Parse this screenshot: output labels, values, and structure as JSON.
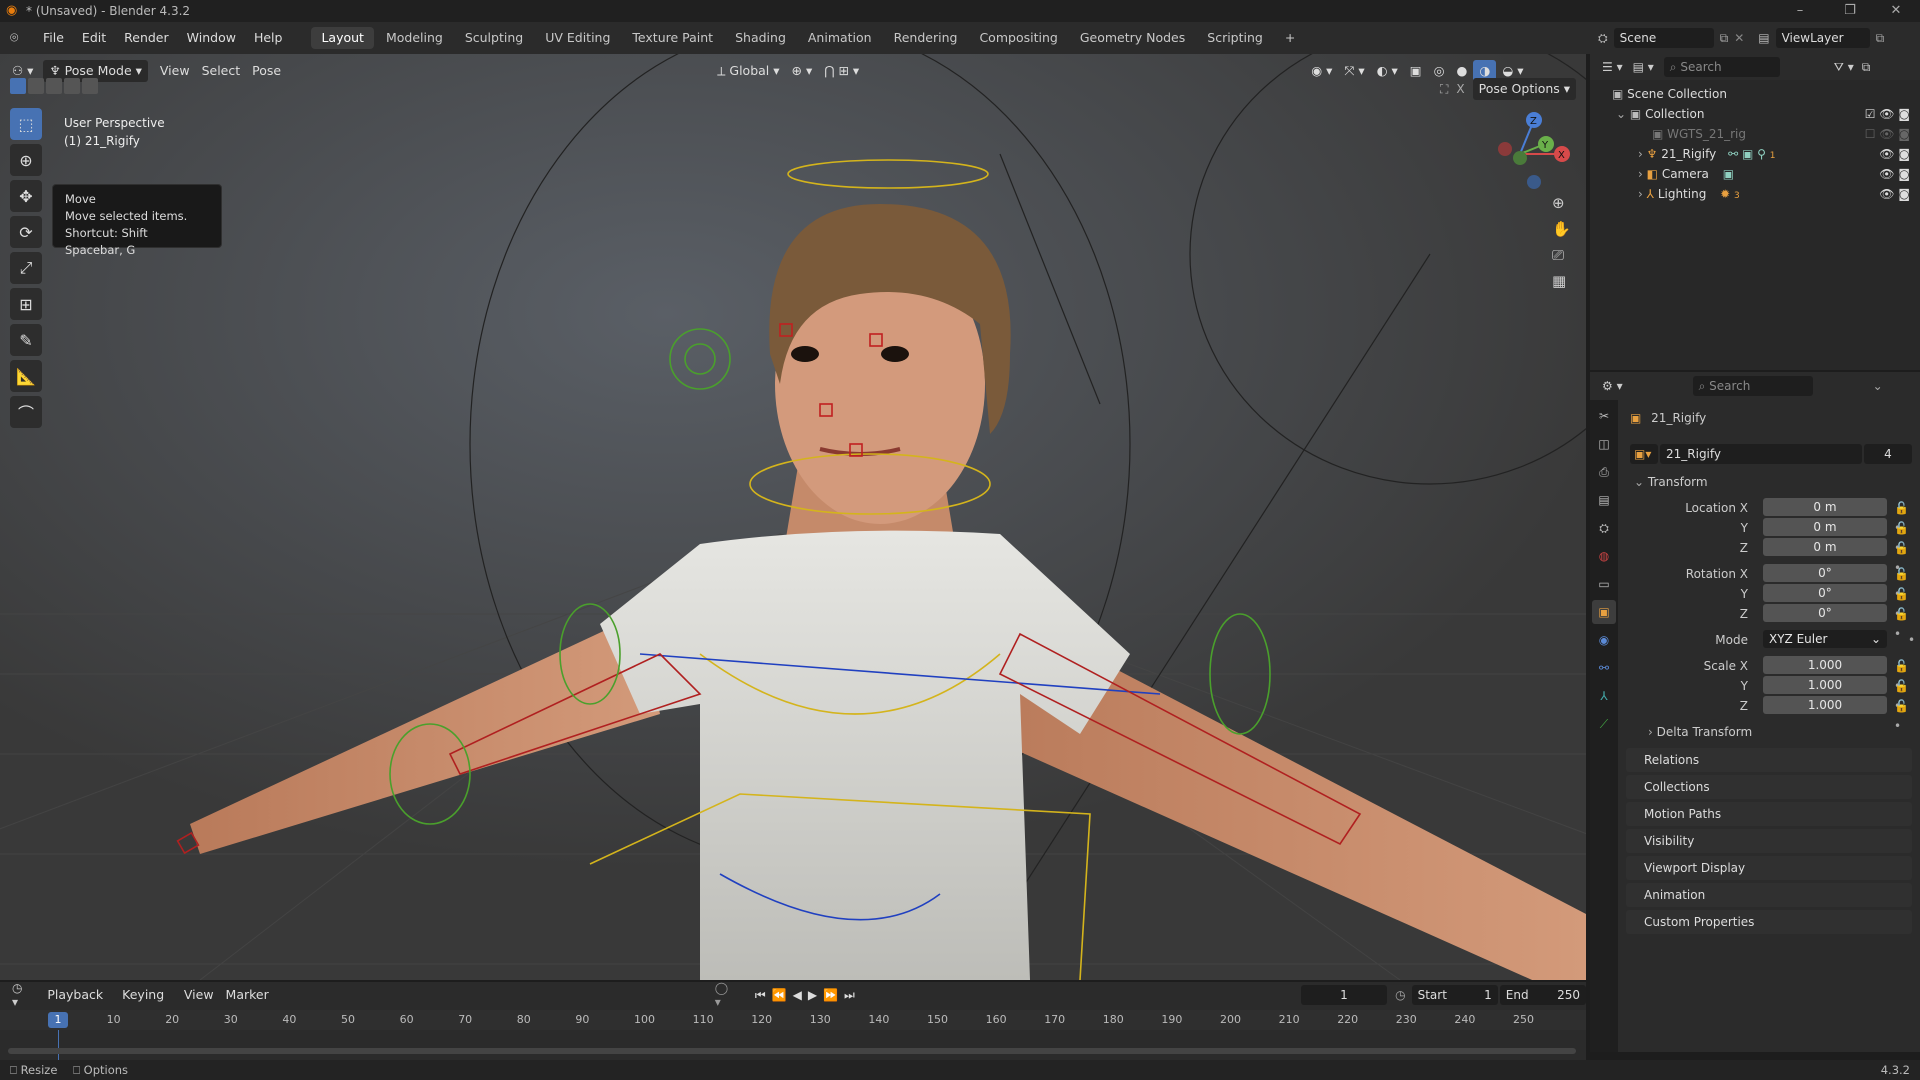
{
  "window": {
    "title": "* (Unsaved) - Blender 4.3.2",
    "controls": [
      "–",
      "❐",
      "✕"
    ]
  },
  "menus": [
    "File",
    "Edit",
    "Render",
    "Window",
    "Help"
  ],
  "workspaces": [
    "Layout",
    "Modeling",
    "Sculpting",
    "UV Editing",
    "Texture Paint",
    "Shading",
    "Animation",
    "Rendering",
    "Compositing",
    "Geometry Nodes",
    "Scripting",
    "+"
  ],
  "scene": {
    "scene_name": "Scene",
    "view_layer": "ViewLayer"
  },
  "viewport": {
    "mode": "Pose Mode",
    "menus": [
      "View",
      "Select",
      "Pose"
    ],
    "orientation": "Global",
    "pose_options": "Pose Options",
    "perspective": "User Perspective",
    "object_label": "(1) 21_Rigify",
    "gizmo_axes": {
      "x": "X",
      "y": "Y",
      "z": "Z"
    },
    "tooltip": {
      "title": "Move",
      "desc": "Move selected items.",
      "shortcut": "Shortcut: Shift Spacebar, G"
    }
  },
  "outliner": {
    "search_placeholder": "Search",
    "items": [
      {
        "label": "Scene Collection",
        "indent": 0
      },
      {
        "label": "Collection",
        "indent": 1
      },
      {
        "label": "WGTS_21_rig",
        "indent": 2
      },
      {
        "label": "21_Rigify",
        "indent": 2
      },
      {
        "label": "Camera",
        "indent": 2
      },
      {
        "label": "Lighting",
        "indent": 2
      }
    ],
    "lighting_count": "3",
    "rigify_count": "1"
  },
  "properties": {
    "search_placeholder": "Search",
    "object_name": "21_Rigify",
    "datablock_name": "21_Rigify",
    "users": "4",
    "transform_title": "Transform",
    "location": {
      "label": "Location X",
      "x": "0 m",
      "y": "0 m",
      "z": "0 m"
    },
    "rotation": {
      "label": "Rotation X",
      "x": "0°",
      "y": "0°",
      "z": "0°"
    },
    "mode_label": "Mode",
    "mode_value": "XYZ Euler",
    "scale": {
      "label": "Scale X",
      "x": "1.000",
      "y": "1.000",
      "z": "1.000"
    },
    "axis_y": "Y",
    "axis_z": "Z",
    "delta_transform": "Delta Transform",
    "sections": [
      "Relations",
      "Collections",
      "Motion Paths",
      "Visibility",
      "Viewport Display",
      "Animation",
      "Custom Properties"
    ]
  },
  "timeline": {
    "menus": [
      "Playback",
      "Keying",
      "View",
      "Marker"
    ],
    "current_frame": "1",
    "start_label": "Start",
    "start_value": "1",
    "end_label": "End",
    "end_value": "250",
    "playhead": "1",
    "ticks": [
      "10",
      "20",
      "30",
      "40",
      "50",
      "60",
      "70",
      "80",
      "90",
      "100",
      "110",
      "120",
      "130",
      "140",
      "150",
      "160",
      "170",
      "180",
      "190",
      "200",
      "210",
      "220",
      "230",
      "240",
      "250"
    ]
  },
  "statusbar": {
    "resize": "Resize",
    "options": "Options",
    "version": "4.3.2"
  },
  "colors": {
    "accent": "#4772b3",
    "blender_orange": "#e87d0d",
    "bone_yellow": "#d4b41c",
    "bone_red": "#b02020",
    "bone_green": "#4aa02c",
    "bone_blue": "#2040c0"
  }
}
